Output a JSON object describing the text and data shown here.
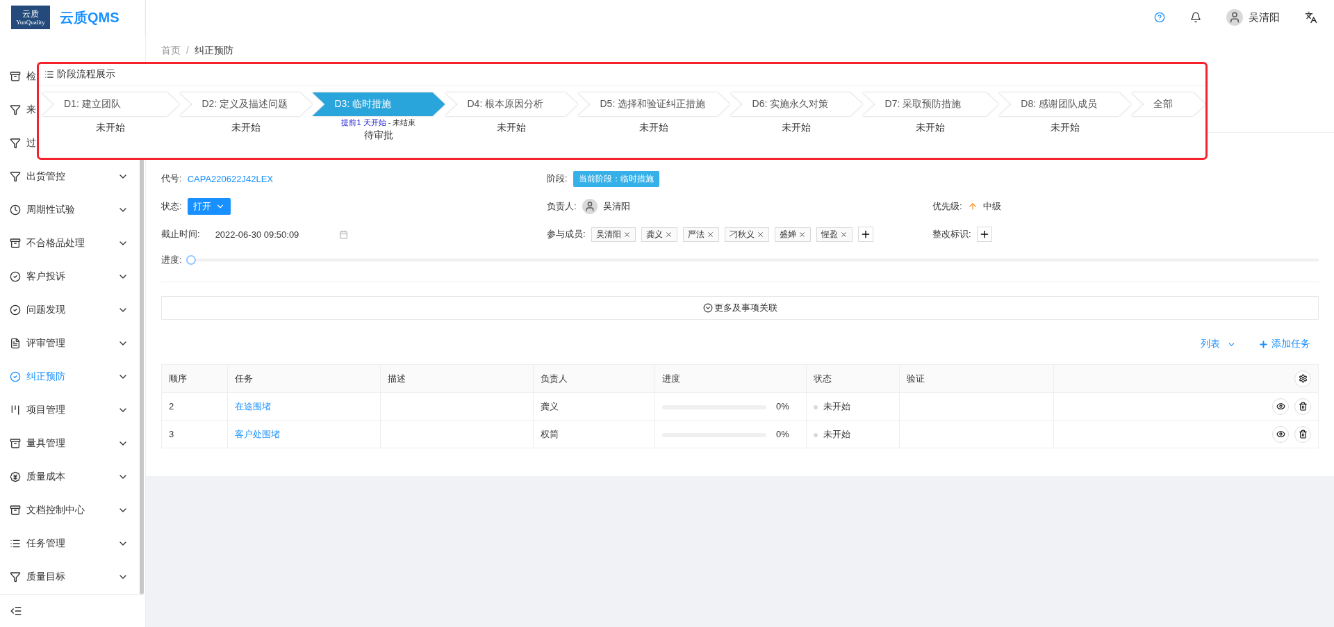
{
  "header": {
    "logo_mark": "云质",
    "logo_sub": "YunQuality",
    "app_name": "云质QMS",
    "user": "吴清阳"
  },
  "sidebar": {
    "items": [
      {
        "label": "检",
        "selected": false
      },
      {
        "label": "来",
        "selected": false
      },
      {
        "label": "过",
        "selected": false
      },
      {
        "label": "出货管控",
        "selected": false
      },
      {
        "label": "周期性试验",
        "selected": false
      },
      {
        "label": "不合格品处理",
        "selected": false
      },
      {
        "label": "客户投诉",
        "selected": false
      },
      {
        "label": "问题发现",
        "selected": false
      },
      {
        "label": "评审管理",
        "selected": false
      },
      {
        "label": "纠正预防",
        "selected": true
      },
      {
        "label": "项目管理",
        "selected": false
      },
      {
        "label": "量具管理",
        "selected": false
      },
      {
        "label": "质量成本",
        "selected": false
      },
      {
        "label": "文档控制中心",
        "selected": false
      },
      {
        "label": "任务管理",
        "selected": false
      },
      {
        "label": "质量目标",
        "selected": false
      }
    ]
  },
  "breadcrumb": {
    "items": [
      "首页",
      "纠正预防"
    ],
    "separator": "/"
  },
  "stage_popup": {
    "title": "阶段流程展示",
    "stages": [
      {
        "label": "D1: 建立团队",
        "status": "未开始",
        "selected": false
      },
      {
        "label": "D2: 定义及描述问题",
        "status": "未开始",
        "selected": false
      },
      {
        "label": "D3: 临时措施",
        "status": "待审批",
        "selected": true,
        "note_start": "提前1 天开始",
        "note_end": "- 未结束"
      },
      {
        "label": "D4: 根本原因分析",
        "status": "未开始",
        "selected": false
      },
      {
        "label": "D5: 选择和验证纠正措施",
        "status": "未开始",
        "selected": false
      },
      {
        "label": "D6: 实施永久对策",
        "status": "未开始",
        "selected": false
      },
      {
        "label": "D7: 采取预防措施",
        "status": "未开始",
        "selected": false
      },
      {
        "label": "D8: 感谢团队成员",
        "status": "未开始",
        "selected": false
      },
      {
        "label": "全部",
        "selected": false
      }
    ]
  },
  "form": {
    "code_label": "代号:",
    "code": "CAPA220622J42LEX",
    "stage_label": "阶段:",
    "stage_tag": "当前阶段：临时措施",
    "status_label": "状态:",
    "status": "打开",
    "owner_label": "负责人:",
    "owner": "吴清阳",
    "priority_label": "优先级:",
    "priority": "中级",
    "deadline_label": "截止时间:",
    "deadline": "2022-06-30 09:50:09",
    "members_label": "参与成员:",
    "members": [
      "吴清阳",
      "龚义",
      "严法",
      "刁秋义",
      "盛婵",
      "惺盈"
    ],
    "mark_label": "整改标识:",
    "progress_label": "进度:",
    "progress": {
      "level": 0
    }
  },
  "more_link": "更多及事项关联",
  "toolbar": {
    "view": "列表",
    "add": "添加任务"
  },
  "tasks": {
    "columns": [
      "顺序",
      "任务",
      "描述",
      "负责人",
      "进度",
      "状态",
      "验证"
    ],
    "rows": [
      {
        "order": "2",
        "task": "在途围堵",
        "owner": "龚义",
        "level": 0,
        "percent": "0%",
        "status": "未开始"
      },
      {
        "order": "3",
        "task": "客户处围堵",
        "owner": "权简",
        "level": 0,
        "percent": "0%",
        "status": "未开始"
      }
    ]
  }
}
